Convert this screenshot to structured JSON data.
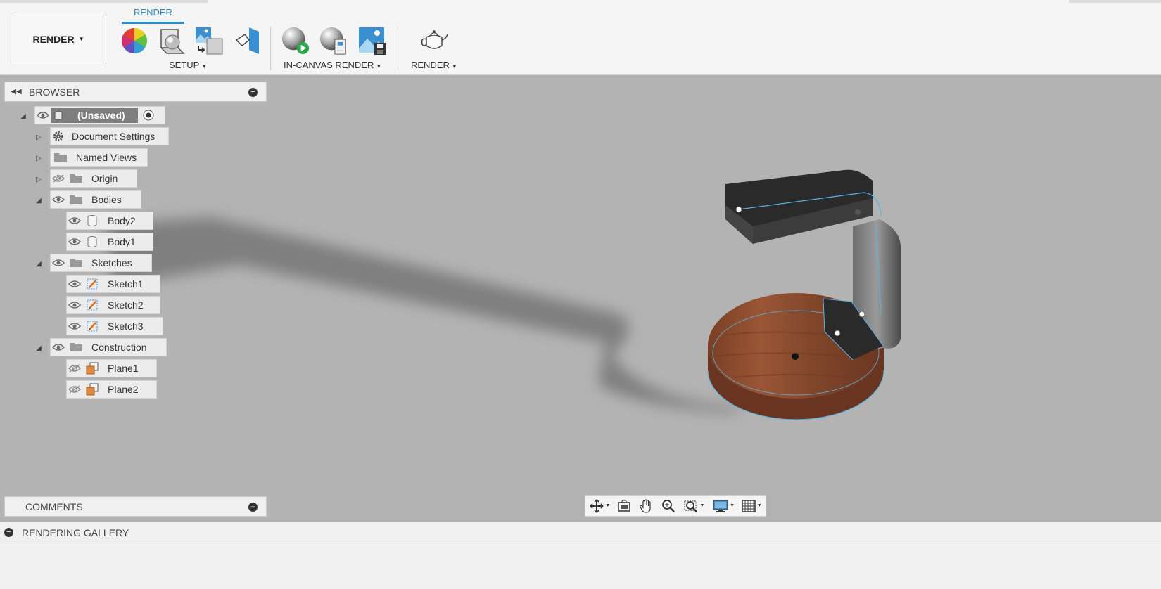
{
  "toolbar": {
    "workspace_label": "RENDER",
    "active_tab": "RENDER",
    "groups": {
      "setup": "SETUP",
      "in_canvas_render": "IN-CANVAS RENDER",
      "render": "RENDER"
    },
    "tools": [
      {
        "name": "appearance-icon"
      },
      {
        "name": "scene-settings-icon"
      },
      {
        "name": "texture-map-icon"
      },
      {
        "name": "decal-icon"
      },
      {
        "name": "in-canvas-render-icon"
      },
      {
        "name": "in-canvas-settings-icon"
      },
      {
        "name": "capture-image-icon"
      },
      {
        "name": "render-teapot-icon"
      }
    ]
  },
  "browser": {
    "title": "BROWSER",
    "root": "(Unsaved)",
    "items": {
      "document_settings": "Document Settings",
      "named_views": "Named Views",
      "origin": "Origin",
      "bodies": "Bodies",
      "body2": "Body2",
      "body1": "Body1",
      "sketches": "Sketches",
      "sketch1": "Sketch1",
      "sketch2": "Sketch2",
      "sketch3": "Sketch3",
      "construction": "Construction",
      "plane1": "Plane1",
      "plane2": "Plane2"
    }
  },
  "comments": {
    "title": "COMMENTS"
  },
  "gallery": {
    "title": "RENDERING GALLERY"
  },
  "colors": {
    "accent": "#2f88c8",
    "canvas": "#b3b3b3",
    "wood": "#8a4a2c",
    "dark_body": "#2a2a2a",
    "edge_highlight": "#5ab4e6"
  }
}
